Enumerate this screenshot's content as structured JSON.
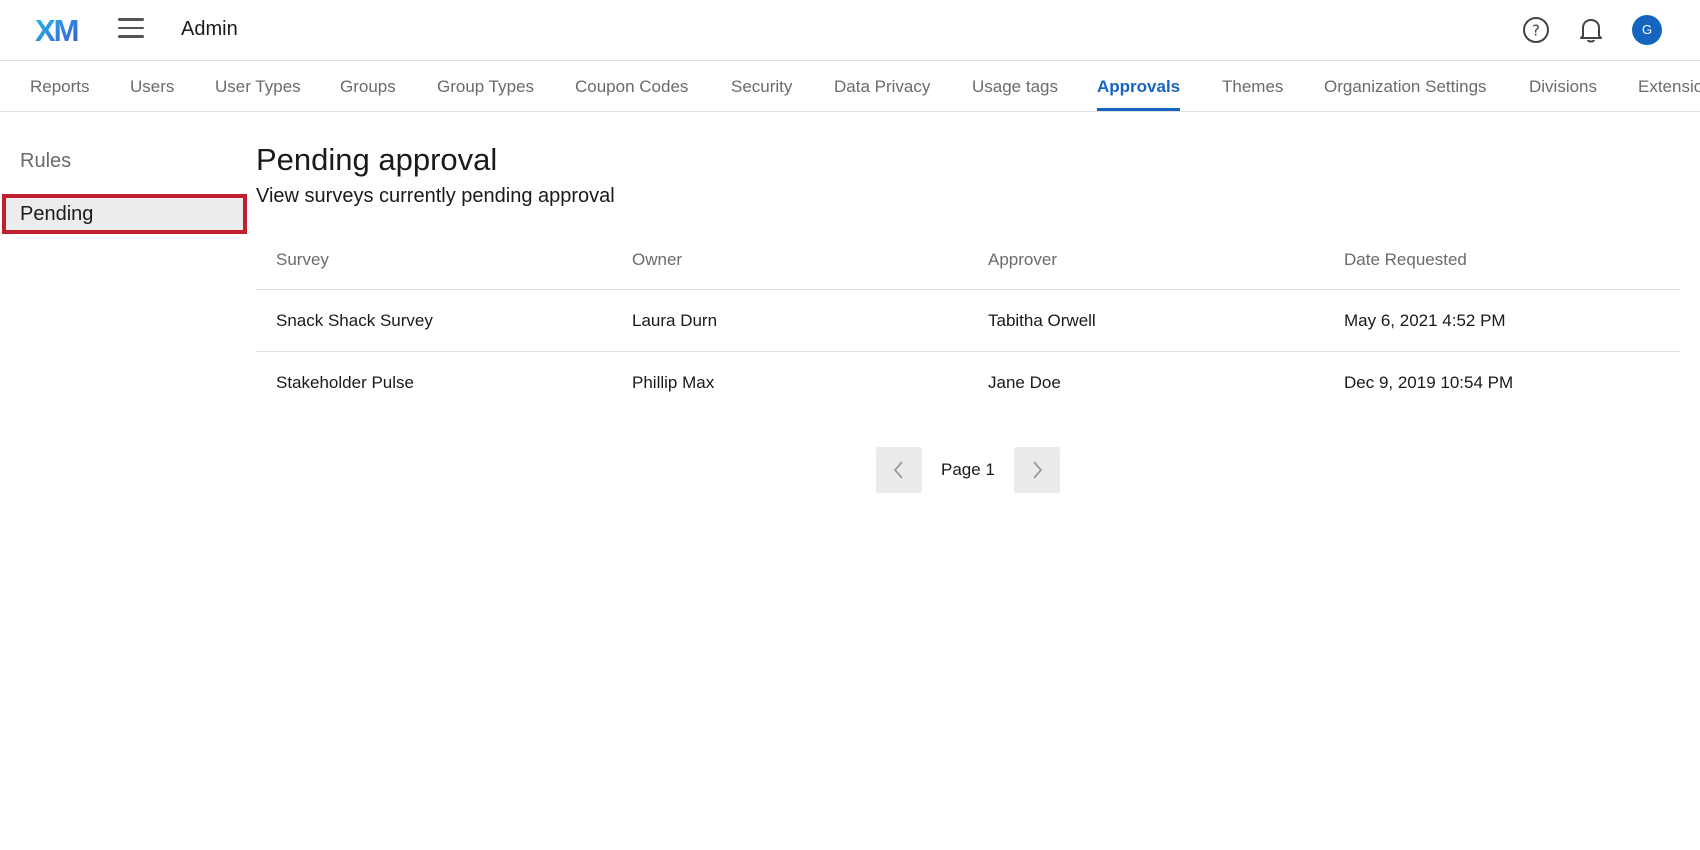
{
  "header": {
    "logo_text": "XM",
    "app_title": "Admin",
    "avatar_initial": "G"
  },
  "tabs": [
    {
      "label": "Reports",
      "active": false
    },
    {
      "label": "Users",
      "active": false
    },
    {
      "label": "User Types",
      "active": false
    },
    {
      "label": "Groups",
      "active": false
    },
    {
      "label": "Group Types",
      "active": false
    },
    {
      "label": "Coupon Codes",
      "active": false
    },
    {
      "label": "Security",
      "active": false
    },
    {
      "label": "Data Privacy",
      "active": false
    },
    {
      "label": "Usage tags",
      "active": false
    },
    {
      "label": "Approvals",
      "active": true
    },
    {
      "label": "Themes",
      "active": false
    },
    {
      "label": "Organization Settings",
      "active": false
    },
    {
      "label": "Divisions",
      "active": false
    },
    {
      "label": "Extensio",
      "active": false
    }
  ],
  "sidebar": {
    "items": [
      {
        "label": "Rules",
        "selected": false
      },
      {
        "label": "Pending",
        "selected": true
      }
    ]
  },
  "main": {
    "title": "Pending approval",
    "subtitle": "View surveys currently pending approval",
    "table": {
      "columns": [
        "Survey",
        "Owner",
        "Approver",
        "Date Requested"
      ],
      "rows": [
        [
          "Snack Shack Survey",
          "Laura Durn",
          "Tabitha Orwell",
          "May 6, 2021 4:52 PM"
        ],
        [
          "Stakeholder Pulse",
          "Phillip Max",
          "Jane Doe",
          "Dec 9, 2019 10:54 PM"
        ]
      ]
    },
    "pagination": {
      "label": "Page 1"
    }
  },
  "colors": {
    "accent": "#1565c0",
    "highlight_border": "#c0202e",
    "logo_gradient_start": "#21c3e8",
    "logo_gradient_end": "#3f51d8"
  },
  "icons": {
    "menu": "hamburger-menu-icon",
    "help": "help-circle-icon",
    "notifications": "bell-icon",
    "prev": "chevron-left-icon",
    "next": "chevron-right-icon"
  }
}
